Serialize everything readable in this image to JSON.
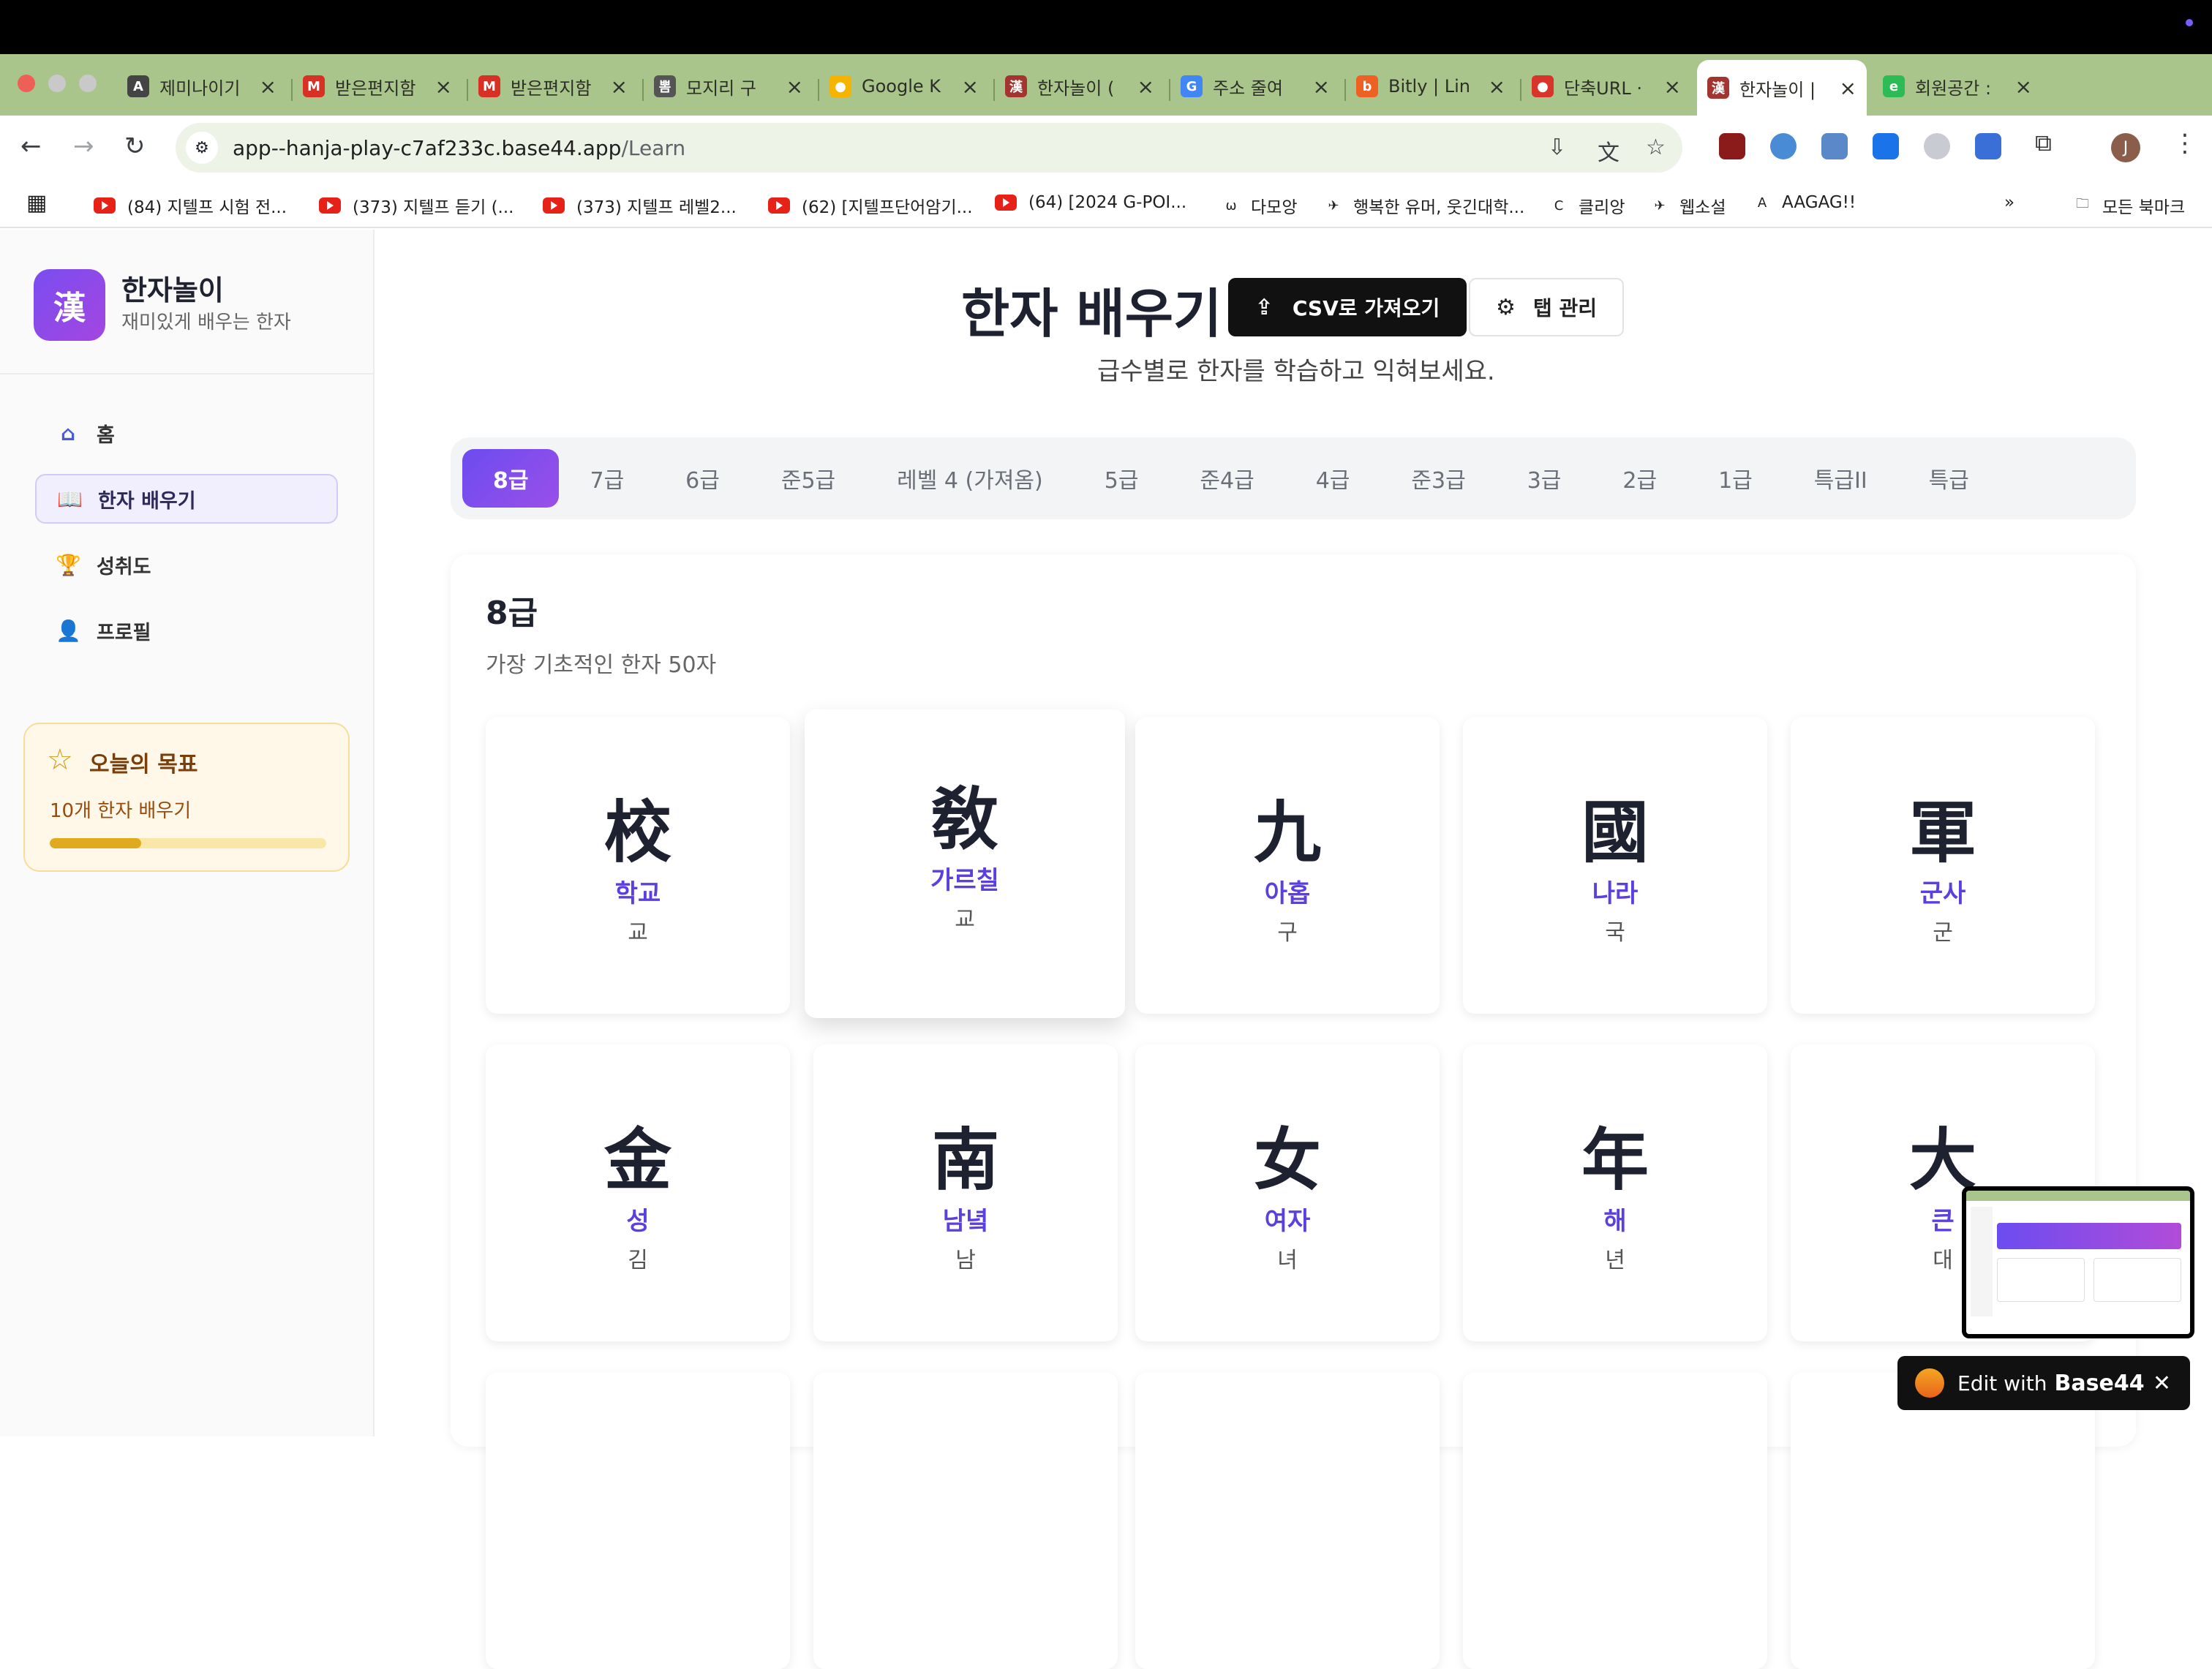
{
  "browser": {
    "tabs": [
      {
        "title": "제미나이기",
        "fav": "A",
        "color": "#444"
      },
      {
        "title": "받은편지함",
        "fav": "M",
        "color": "#d93025"
      },
      {
        "title": "받은편지함",
        "fav": "M",
        "color": "#d93025"
      },
      {
        "title": "모지리 구",
        "fav": "뽐",
        "color": "#555"
      },
      {
        "title": "Google K",
        "fav": "●",
        "color": "#f5b400"
      },
      {
        "title": "한자놀이 (",
        "fav": "漢",
        "color": "#a3342f"
      },
      {
        "title": "주소 줄여",
        "fav": "G",
        "color": "#4285f4"
      },
      {
        "title": "Bitly | Lin",
        "fav": "b",
        "color": "#ee6123"
      },
      {
        "title": "단축URL ·",
        "fav": "●",
        "color": "#d9342b"
      },
      {
        "title": "한자놀이 |",
        "fav": "漢",
        "color": "#a3342f"
      },
      {
        "title": "회원공간 :",
        "fav": "e",
        "color": "#2dbb55"
      }
    ],
    "url_host": "app--hanja-play-c7af233c.base44.app",
    "url_path": "/Learn",
    "bookmarks": [
      {
        "label": "(84) 지텔프 시험 전...",
        "type": "yt"
      },
      {
        "label": "(373) 지텔프 듣기 (...",
        "type": "yt"
      },
      {
        "label": "(373) 지텔프 레벨2...",
        "type": "yt"
      },
      {
        "label": "(62) [지텔프단어암기...",
        "type": "yt"
      },
      {
        "label": "(64) [2024 G-POI...",
        "type": "yt"
      },
      {
        "label": "다모앙",
        "type": "other",
        "glyph": "ω"
      },
      {
        "label": "행복한 유머, 웃긴대학...",
        "type": "other",
        "glyph": "✈"
      },
      {
        "label": "클리앙",
        "type": "other",
        "glyph": "C"
      },
      {
        "label": "웹소설",
        "type": "other",
        "glyph": "✈"
      },
      {
        "label": "AAGAG!!",
        "type": "other",
        "glyph": "A"
      }
    ],
    "all_bookmarks": "모든 북마크",
    "more": "»",
    "avatar_initial": "J"
  },
  "sidebar": {
    "logo_char": "漢",
    "brand": "한자놀이",
    "tagline": "재미있게 배우는 한자",
    "nav": [
      {
        "label": "홈",
        "icon": "home-icon"
      },
      {
        "label": "한자 배우기",
        "icon": "book-icon"
      },
      {
        "label": "성취도",
        "icon": "trophy-icon"
      },
      {
        "label": "프로필",
        "icon": "user-icon"
      }
    ],
    "goal": {
      "title": "오늘의 목표",
      "subtitle": "10개 한자 배우기",
      "progress": 0.33
    }
  },
  "main": {
    "title": "한자 배우기",
    "csv_button": "CSV로 가져오기",
    "tab_button": "탭 관리",
    "subtitle": "급수별로 한자를 학습하고 익혀보세요.",
    "levels": [
      "8급",
      "7급",
      "6급",
      "준5급",
      "레벨 4 (가져옴)",
      "5급",
      "준4급",
      "4급",
      "준3급",
      "3급",
      "2급",
      "1급",
      "특급II",
      "특급"
    ],
    "group_title": "8급",
    "group_desc": "가장 기초적인 한자 50자",
    "cards": [
      {
        "han": "校",
        "meaning": "학교",
        "sound": "교"
      },
      {
        "han": "敎",
        "meaning": "가르칠",
        "sound": "교"
      },
      {
        "han": "九",
        "meaning": "아홉",
        "sound": "구"
      },
      {
        "han": "國",
        "meaning": "나라",
        "sound": "국"
      },
      {
        "han": "軍",
        "meaning": "군사",
        "sound": "군"
      },
      {
        "han": "金",
        "meaning": "성",
        "sound": "김"
      },
      {
        "han": "南",
        "meaning": "남녘",
        "sound": "남"
      },
      {
        "han": "女",
        "meaning": "여자",
        "sound": "녀"
      },
      {
        "han": "年",
        "meaning": "해",
        "sound": "년"
      },
      {
        "han": "大",
        "meaning": "큰",
        "sound": "대"
      }
    ]
  },
  "edit_badge": {
    "prefix": "Edit with",
    "brand": "Base44"
  }
}
